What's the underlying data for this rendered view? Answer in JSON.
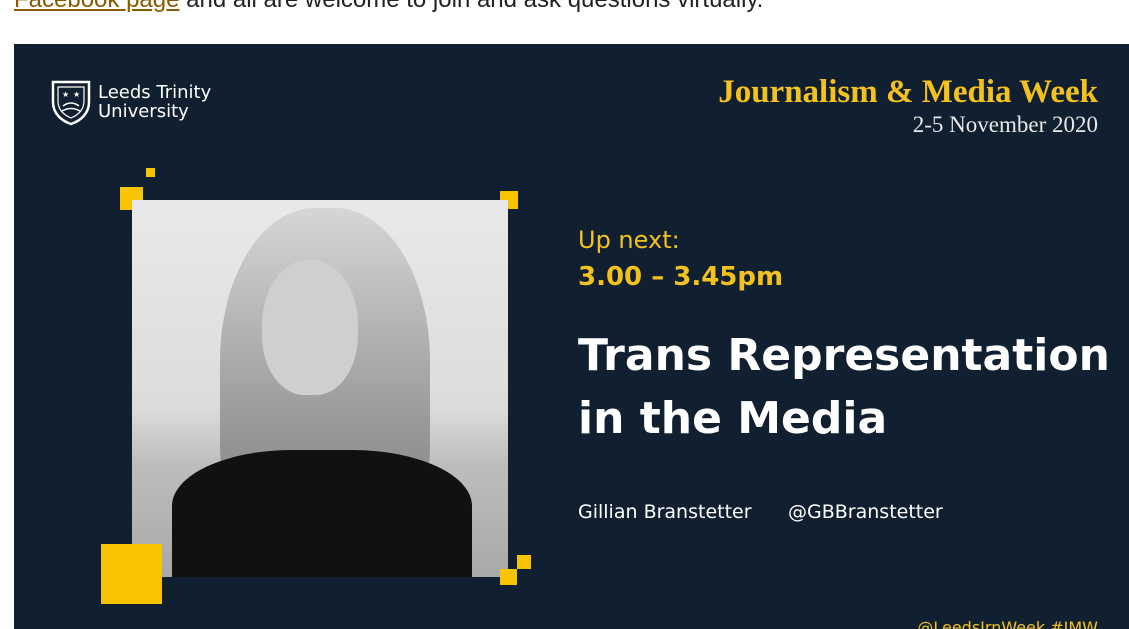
{
  "intro": {
    "link_text": "Facebook page",
    "after_link": " and all are welcome to join and ask questions virtually."
  },
  "banner": {
    "logo": {
      "line1": "Leeds Trinity",
      "line2": "University",
      "icon": "crest-icon"
    },
    "event_title": "Journalism & Media Week",
    "event_dates": "2-5 November 2020",
    "up_next_label": "Up next:",
    "time": "3.00 – 3.45pm",
    "talk_title_line1": "Trans Representation",
    "talk_title_line2": "in the Media",
    "speaker_name": "Gillian Branstetter",
    "speaker_handle": "@GBBranstetter",
    "footer_tag": "@LeedsJrnWeek #JMW",
    "colors": {
      "background": "#102030",
      "accent": "#f8c300",
      "text": "#ffffff"
    }
  }
}
